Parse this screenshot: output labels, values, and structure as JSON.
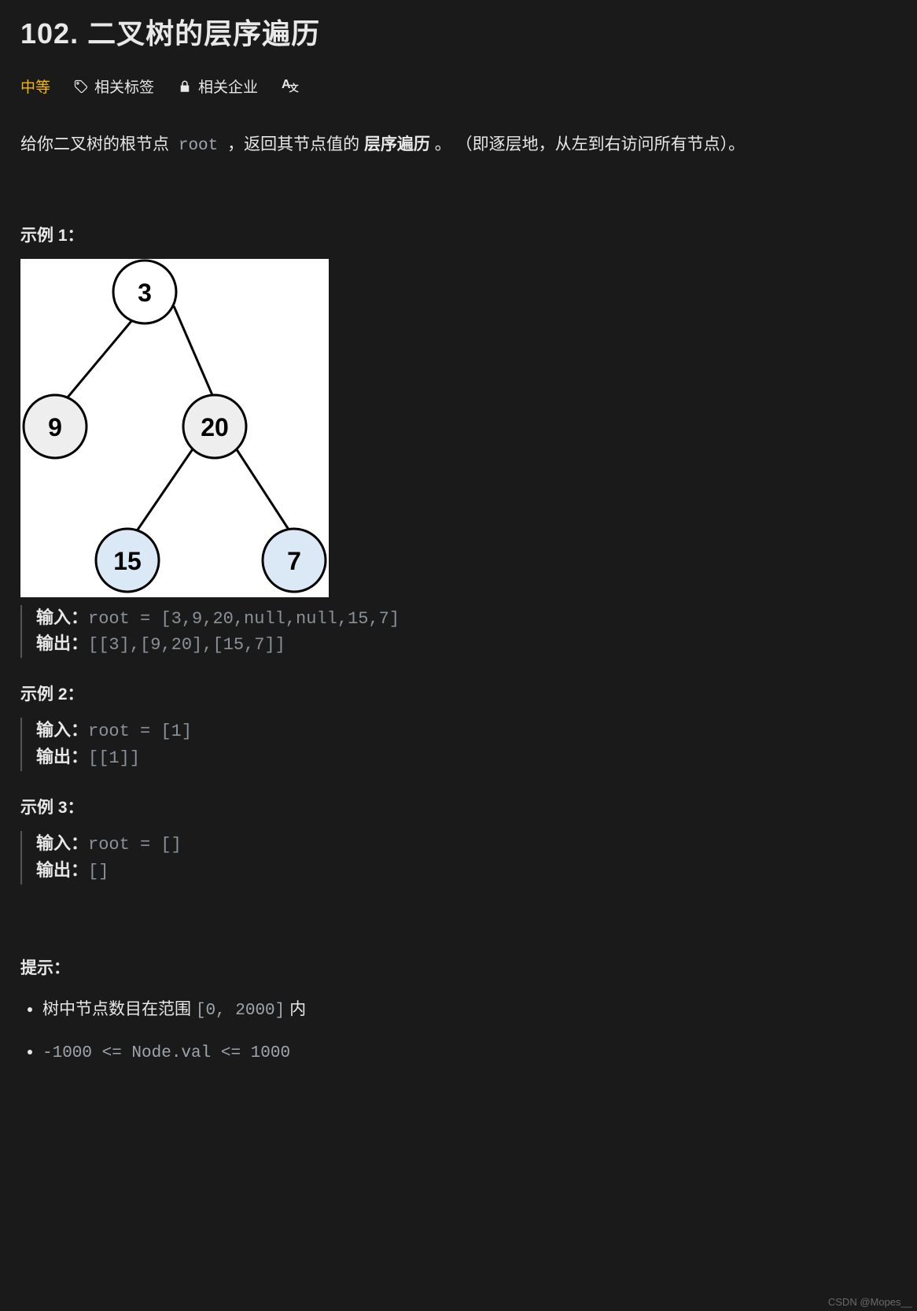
{
  "title": "102. 二叉树的层序遍历",
  "meta": {
    "difficulty": "中等",
    "tags_label": "相关标签",
    "companies_label": "相关企业"
  },
  "description": {
    "pre": "给你二叉树的根节点 ",
    "root_code": "root",
    "mid": " ，返回其节点值的 ",
    "bold": "层序遍历",
    "post": " 。 （即逐层地，从左到右访问所有节点）。"
  },
  "tree": {
    "nodes": {
      "n3": "3",
      "n9": "9",
      "n20": "20",
      "n15": "15",
      "n7": "7"
    }
  },
  "examples": [
    {
      "head": "示例 1：",
      "input_label": "输入：",
      "input_value": "root = [3,9,20,null,null,15,7]",
      "output_label": "输出：",
      "output_value": "[[3],[9,20],[15,7]]"
    },
    {
      "head": "示例 2：",
      "input_label": "输入：",
      "input_value": "root = [1]",
      "output_label": "输出：",
      "output_value": "[[1]]"
    },
    {
      "head": "示例 3：",
      "input_label": "输入：",
      "input_value": "root = []",
      "output_label": "输出：",
      "output_value": "[]"
    }
  ],
  "hints": {
    "head": "提示：",
    "items": [
      {
        "pre": "树中节点数目在范围 ",
        "code": "[0, 2000]",
        "post": " 内"
      },
      {
        "pre": "",
        "code": "-1000 <= Node.val <= 1000",
        "post": ""
      }
    ]
  },
  "watermark": "CSDN @Mopes__"
}
